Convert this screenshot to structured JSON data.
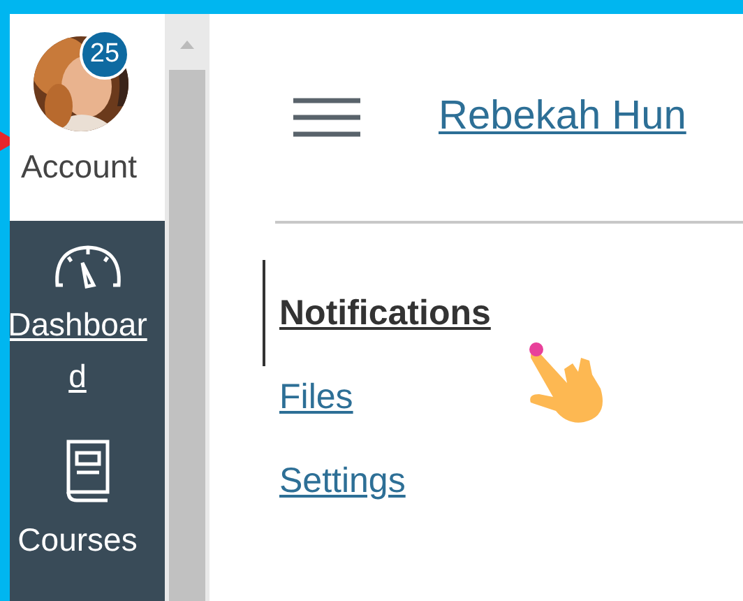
{
  "sidebar": {
    "items": [
      {
        "kind": "account",
        "label": "Account",
        "badge": "25",
        "selected": true
      },
      {
        "kind": "dashboard",
        "label": "Dashboard",
        "selected": false
      },
      {
        "kind": "courses",
        "label": "Courses",
        "selected": false
      }
    ]
  },
  "header": {
    "title": "Rebekah Hun"
  },
  "nav": [
    {
      "label": "Notifications",
      "selected": true
    },
    {
      "label": "Files",
      "selected": false
    },
    {
      "label": "Settings",
      "selected": false
    }
  ]
}
